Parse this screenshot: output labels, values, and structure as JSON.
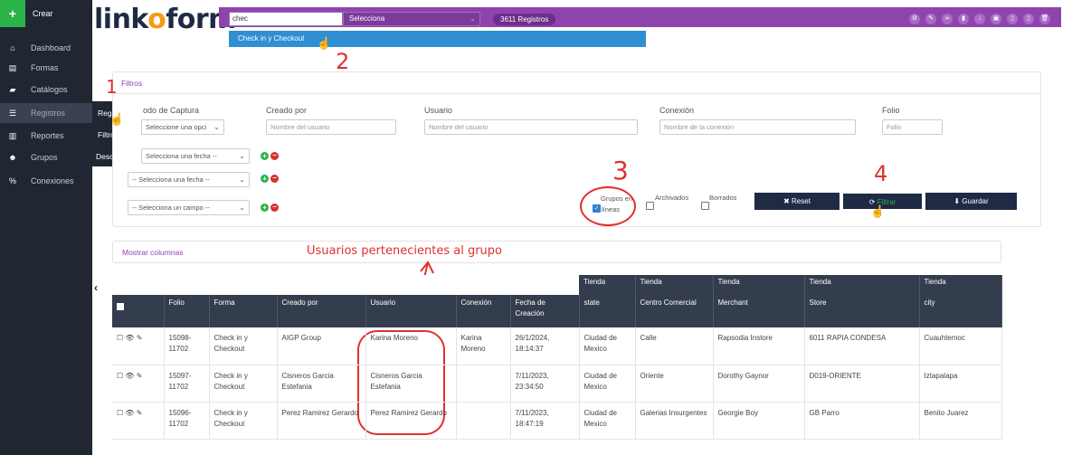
{
  "sidebar": {
    "crear": "Crear",
    "items": [
      {
        "label": "Dashboard",
        "icon": "home-icon"
      },
      {
        "label": "Formas",
        "icon": "file-icon"
      },
      {
        "label": "Catálogos",
        "icon": "book-icon"
      },
      {
        "label": "Registros",
        "icon": "list-icon"
      },
      {
        "label": "Reportes",
        "icon": "chart-icon"
      },
      {
        "label": "Grupos",
        "icon": "users-icon"
      },
      {
        "label": "Conexiones",
        "icon": "link-icon"
      }
    ],
    "submenu": [
      "Registros",
      "Filtros",
      "Descargas"
    ]
  },
  "logo": {
    "part1": "link",
    "part2": "o",
    "part3": "form"
  },
  "topbar": {
    "search_value": "chec",
    "select_label": "Selecciona",
    "registros_count": "3611 Registros",
    "suggestion": "Check in y Checkout",
    "accent": "#8e44ad"
  },
  "filters": {
    "title": "Filtros",
    "metodo_label": "odo de Captura",
    "metodo_select": "Seleccione una opci",
    "creado_label": "Creado por",
    "creado_placeholder": "Nombre del usuario",
    "usuario_label": "Usuario",
    "usuario_placeholder": "Nombre del usuario",
    "conexion_label": "Conexión",
    "conexion_placeholder": "Nombre de la conexión",
    "folio_label": "Folio",
    "folio_placeholder": "Folio",
    "fecha1": "Selecciona una fecha --",
    "fecha2": "-- Selecciona una fecha --",
    "campo": "-- Selecciona un campo --",
    "grupos_label1": "Grupos en",
    "grupos_label2": "líneas",
    "archivados": "Archivados",
    "borrados": "Borrados",
    "reset": "Reset",
    "filtrar": "Filtrar",
    "guardar": "Guardar"
  },
  "mostrar_columnas": "Mostrar columnas",
  "annotations": {
    "n1": "1",
    "n2": "2",
    "n3": "3",
    "n4": "4",
    "note": "Usuarios pertenecientes al grupo"
  },
  "table": {
    "group_header": "Tienda",
    "headers": [
      "Folio",
      "Forma",
      "Creado por",
      "Usuario",
      "Conexión",
      "Fecha de Creación",
      "state",
      "Centro Comercial",
      "Merchant",
      "Store",
      "city"
    ],
    "rows": [
      [
        "15098-11702",
        "Check in y Checkout",
        "AIGP Group",
        "Karina Moreno",
        "Karina Moreno",
        "26/1/2024, 18:14:37",
        "Ciudad de Mexico",
        "Calle",
        "Rapsodia Instore",
        "6011 RAPIA CONDESA",
        "Cuauhtemoc"
      ],
      [
        "15097-11702",
        "Check in y Checkout",
        "Cisneros Garcia Estefania",
        "Cisneros Garcia Estefania",
        "",
        "7/11/2023, 23:34:50",
        "Ciudad de Mexico",
        "Oriente",
        "Dorothy Gaynor",
        "D019-ORIENTE",
        "Iztapalapa"
      ],
      [
        "15096-11702",
        "Check in y Checkout",
        "Perez Ramirez Gerardo",
        "Perez Ramirez Gerardo",
        "",
        "7/11/2023, 18:47:19",
        "Ciudad de Mexico",
        "Galerias Insurgentes",
        "Georgie Boy",
        "GB Parro",
        "Benito Juarez"
      ]
    ]
  }
}
